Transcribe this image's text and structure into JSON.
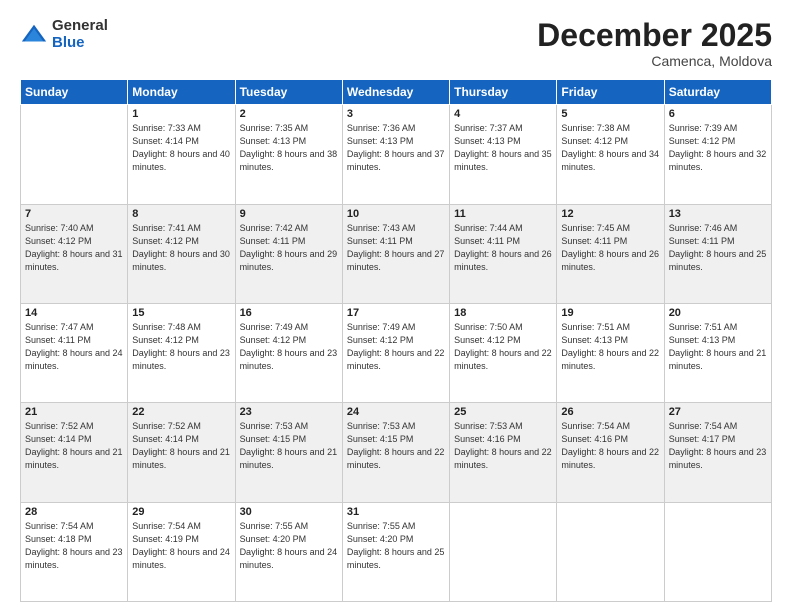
{
  "logo": {
    "general": "General",
    "blue": "Blue"
  },
  "header": {
    "month": "December 2025",
    "location": "Camenca, Moldova"
  },
  "weekdays": [
    "Sunday",
    "Monday",
    "Tuesday",
    "Wednesday",
    "Thursday",
    "Friday",
    "Saturday"
  ],
  "weeks": [
    [
      {
        "num": "",
        "sunrise": "",
        "sunset": "",
        "daylight": ""
      },
      {
        "num": "1",
        "sunrise": "Sunrise: 7:33 AM",
        "sunset": "Sunset: 4:14 PM",
        "daylight": "Daylight: 8 hours and 40 minutes."
      },
      {
        "num": "2",
        "sunrise": "Sunrise: 7:35 AM",
        "sunset": "Sunset: 4:13 PM",
        "daylight": "Daylight: 8 hours and 38 minutes."
      },
      {
        "num": "3",
        "sunrise": "Sunrise: 7:36 AM",
        "sunset": "Sunset: 4:13 PM",
        "daylight": "Daylight: 8 hours and 37 minutes."
      },
      {
        "num": "4",
        "sunrise": "Sunrise: 7:37 AM",
        "sunset": "Sunset: 4:13 PM",
        "daylight": "Daylight: 8 hours and 35 minutes."
      },
      {
        "num": "5",
        "sunrise": "Sunrise: 7:38 AM",
        "sunset": "Sunset: 4:12 PM",
        "daylight": "Daylight: 8 hours and 34 minutes."
      },
      {
        "num": "6",
        "sunrise": "Sunrise: 7:39 AM",
        "sunset": "Sunset: 4:12 PM",
        "daylight": "Daylight: 8 hours and 32 minutes."
      }
    ],
    [
      {
        "num": "7",
        "sunrise": "Sunrise: 7:40 AM",
        "sunset": "Sunset: 4:12 PM",
        "daylight": "Daylight: 8 hours and 31 minutes."
      },
      {
        "num": "8",
        "sunrise": "Sunrise: 7:41 AM",
        "sunset": "Sunset: 4:12 PM",
        "daylight": "Daylight: 8 hours and 30 minutes."
      },
      {
        "num": "9",
        "sunrise": "Sunrise: 7:42 AM",
        "sunset": "Sunset: 4:11 PM",
        "daylight": "Daylight: 8 hours and 29 minutes."
      },
      {
        "num": "10",
        "sunrise": "Sunrise: 7:43 AM",
        "sunset": "Sunset: 4:11 PM",
        "daylight": "Daylight: 8 hours and 27 minutes."
      },
      {
        "num": "11",
        "sunrise": "Sunrise: 7:44 AM",
        "sunset": "Sunset: 4:11 PM",
        "daylight": "Daylight: 8 hours and 26 minutes."
      },
      {
        "num": "12",
        "sunrise": "Sunrise: 7:45 AM",
        "sunset": "Sunset: 4:11 PM",
        "daylight": "Daylight: 8 hours and 26 minutes."
      },
      {
        "num": "13",
        "sunrise": "Sunrise: 7:46 AM",
        "sunset": "Sunset: 4:11 PM",
        "daylight": "Daylight: 8 hours and 25 minutes."
      }
    ],
    [
      {
        "num": "14",
        "sunrise": "Sunrise: 7:47 AM",
        "sunset": "Sunset: 4:11 PM",
        "daylight": "Daylight: 8 hours and 24 minutes."
      },
      {
        "num": "15",
        "sunrise": "Sunrise: 7:48 AM",
        "sunset": "Sunset: 4:12 PM",
        "daylight": "Daylight: 8 hours and 23 minutes."
      },
      {
        "num": "16",
        "sunrise": "Sunrise: 7:49 AM",
        "sunset": "Sunset: 4:12 PM",
        "daylight": "Daylight: 8 hours and 23 minutes."
      },
      {
        "num": "17",
        "sunrise": "Sunrise: 7:49 AM",
        "sunset": "Sunset: 4:12 PM",
        "daylight": "Daylight: 8 hours and 22 minutes."
      },
      {
        "num": "18",
        "sunrise": "Sunrise: 7:50 AM",
        "sunset": "Sunset: 4:12 PM",
        "daylight": "Daylight: 8 hours and 22 minutes."
      },
      {
        "num": "19",
        "sunrise": "Sunrise: 7:51 AM",
        "sunset": "Sunset: 4:13 PM",
        "daylight": "Daylight: 8 hours and 22 minutes."
      },
      {
        "num": "20",
        "sunrise": "Sunrise: 7:51 AM",
        "sunset": "Sunset: 4:13 PM",
        "daylight": "Daylight: 8 hours and 21 minutes."
      }
    ],
    [
      {
        "num": "21",
        "sunrise": "Sunrise: 7:52 AM",
        "sunset": "Sunset: 4:14 PM",
        "daylight": "Daylight: 8 hours and 21 minutes."
      },
      {
        "num": "22",
        "sunrise": "Sunrise: 7:52 AM",
        "sunset": "Sunset: 4:14 PM",
        "daylight": "Daylight: 8 hours and 21 minutes."
      },
      {
        "num": "23",
        "sunrise": "Sunrise: 7:53 AM",
        "sunset": "Sunset: 4:15 PM",
        "daylight": "Daylight: 8 hours and 21 minutes."
      },
      {
        "num": "24",
        "sunrise": "Sunrise: 7:53 AM",
        "sunset": "Sunset: 4:15 PM",
        "daylight": "Daylight: 8 hours and 22 minutes."
      },
      {
        "num": "25",
        "sunrise": "Sunrise: 7:53 AM",
        "sunset": "Sunset: 4:16 PM",
        "daylight": "Daylight: 8 hours and 22 minutes."
      },
      {
        "num": "26",
        "sunrise": "Sunrise: 7:54 AM",
        "sunset": "Sunset: 4:16 PM",
        "daylight": "Daylight: 8 hours and 22 minutes."
      },
      {
        "num": "27",
        "sunrise": "Sunrise: 7:54 AM",
        "sunset": "Sunset: 4:17 PM",
        "daylight": "Daylight: 8 hours and 23 minutes."
      }
    ],
    [
      {
        "num": "28",
        "sunrise": "Sunrise: 7:54 AM",
        "sunset": "Sunset: 4:18 PM",
        "daylight": "Daylight: 8 hours and 23 minutes."
      },
      {
        "num": "29",
        "sunrise": "Sunrise: 7:54 AM",
        "sunset": "Sunset: 4:19 PM",
        "daylight": "Daylight: 8 hours and 24 minutes."
      },
      {
        "num": "30",
        "sunrise": "Sunrise: 7:55 AM",
        "sunset": "Sunset: 4:20 PM",
        "daylight": "Daylight: 8 hours and 24 minutes."
      },
      {
        "num": "31",
        "sunrise": "Sunrise: 7:55 AM",
        "sunset": "Sunset: 4:20 PM",
        "daylight": "Daylight: 8 hours and 25 minutes."
      },
      {
        "num": "",
        "sunrise": "",
        "sunset": "",
        "daylight": ""
      },
      {
        "num": "",
        "sunrise": "",
        "sunset": "",
        "daylight": ""
      },
      {
        "num": "",
        "sunrise": "",
        "sunset": "",
        "daylight": ""
      }
    ]
  ]
}
